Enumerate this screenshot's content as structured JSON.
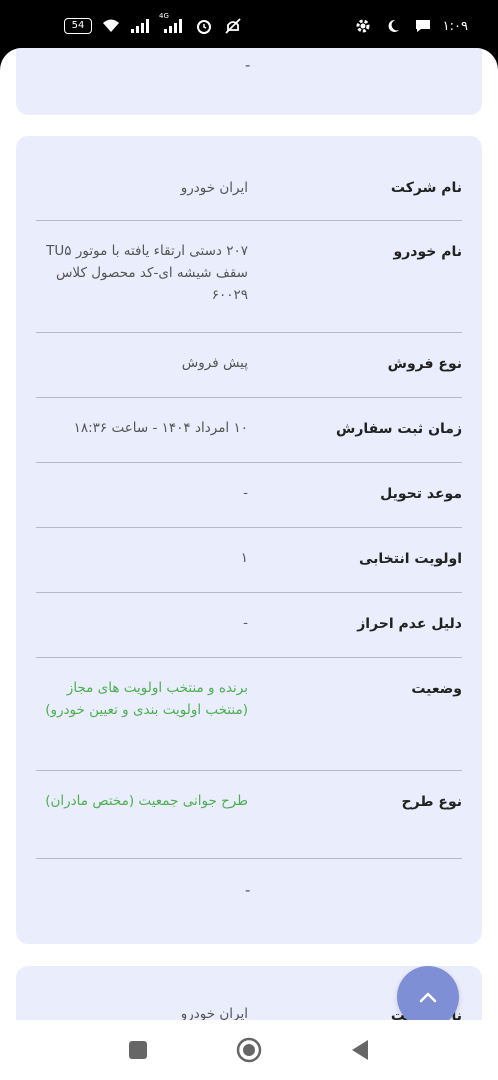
{
  "status_bar": {
    "battery": "54",
    "network": "4G",
    "time": "۱:۰۹"
  },
  "card_top": {
    "value": "-"
  },
  "card_main": {
    "rows": [
      {
        "label": "نام شرکت",
        "value": "ایران خودرو"
      },
      {
        "label": "نام خودرو",
        "value": "۲۰۷ دستی ارتقاء یافته با موتور TU۵ سقف شیشه ای-کد محصول کلاس ۶۰۰۲۹"
      },
      {
        "label": "نوع فروش",
        "value": "پیش فروش"
      },
      {
        "label": "زمان ثبت سفارش",
        "value": "۱۰ امرداد ۱۴۰۴ - ساعت ۱۸:۳۶"
      },
      {
        "label": "موعد تحویل",
        "value": "-"
      },
      {
        "label": "اولویت انتخابی",
        "value": "۱"
      },
      {
        "label": "دلیل عدم احراز",
        "value": "-"
      },
      {
        "label": "وضعیت",
        "value": "برنده و منتخب اولویت های مجاز (منتخب اولویت بندی و تعیین خودرو)"
      },
      {
        "label": "نوع طرح",
        "value": "طرح جوانی جمعیت (مختص مادران)"
      }
    ],
    "footer_value": "-"
  },
  "card_next": {
    "label": "نام شرکت",
    "value": "ایران خودرو"
  },
  "colors": {
    "card_bg": "#eaedfc",
    "fab": "#7f8fd6",
    "status_green": "#4caf50"
  }
}
